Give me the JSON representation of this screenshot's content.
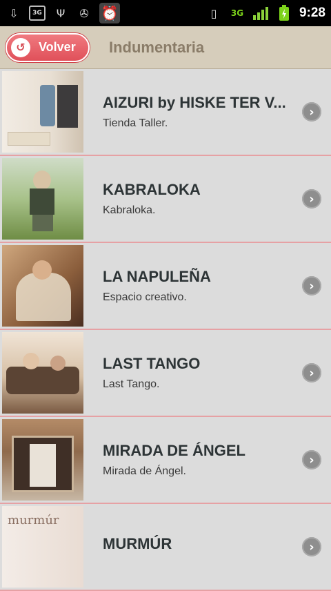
{
  "status_bar": {
    "time": "9:28",
    "icons_left": [
      "download-icon",
      "3g-icon",
      "usb-icon",
      "android-debug-icon",
      "alarm-icon"
    ],
    "icons_right": [
      "vibrate-icon",
      "3g-data-icon",
      "signal-icon",
      "battery-charging-icon"
    ],
    "labels": {
      "three_g": "3G",
      "network": "3G"
    }
  },
  "header": {
    "back_label": "Volver",
    "title": "Indumentaria"
  },
  "items": [
    {
      "title": "AIZURI by HISKE TER V...",
      "subtitle": "Tienda Taller."
    },
    {
      "title": "KABRALOKA",
      "subtitle": "Kabraloka."
    },
    {
      "title": "LA NAPULEÑA",
      "subtitle": "Espacio creativo."
    },
    {
      "title": "LAST TANGO",
      "subtitle": "Last Tango."
    },
    {
      "title": "MIRADA DE ÁNGEL",
      "subtitle": "Mirada de Ángel."
    },
    {
      "title": "MURMÚR",
      "subtitle": ""
    }
  ],
  "thumb_texts": {
    "murmur_sign": "murmúr"
  },
  "colors": {
    "header_bg": "#d6cdbb",
    "back_button": "#e0505a",
    "row_separator": "#e6a1a4",
    "title_text": "#2d3436"
  }
}
